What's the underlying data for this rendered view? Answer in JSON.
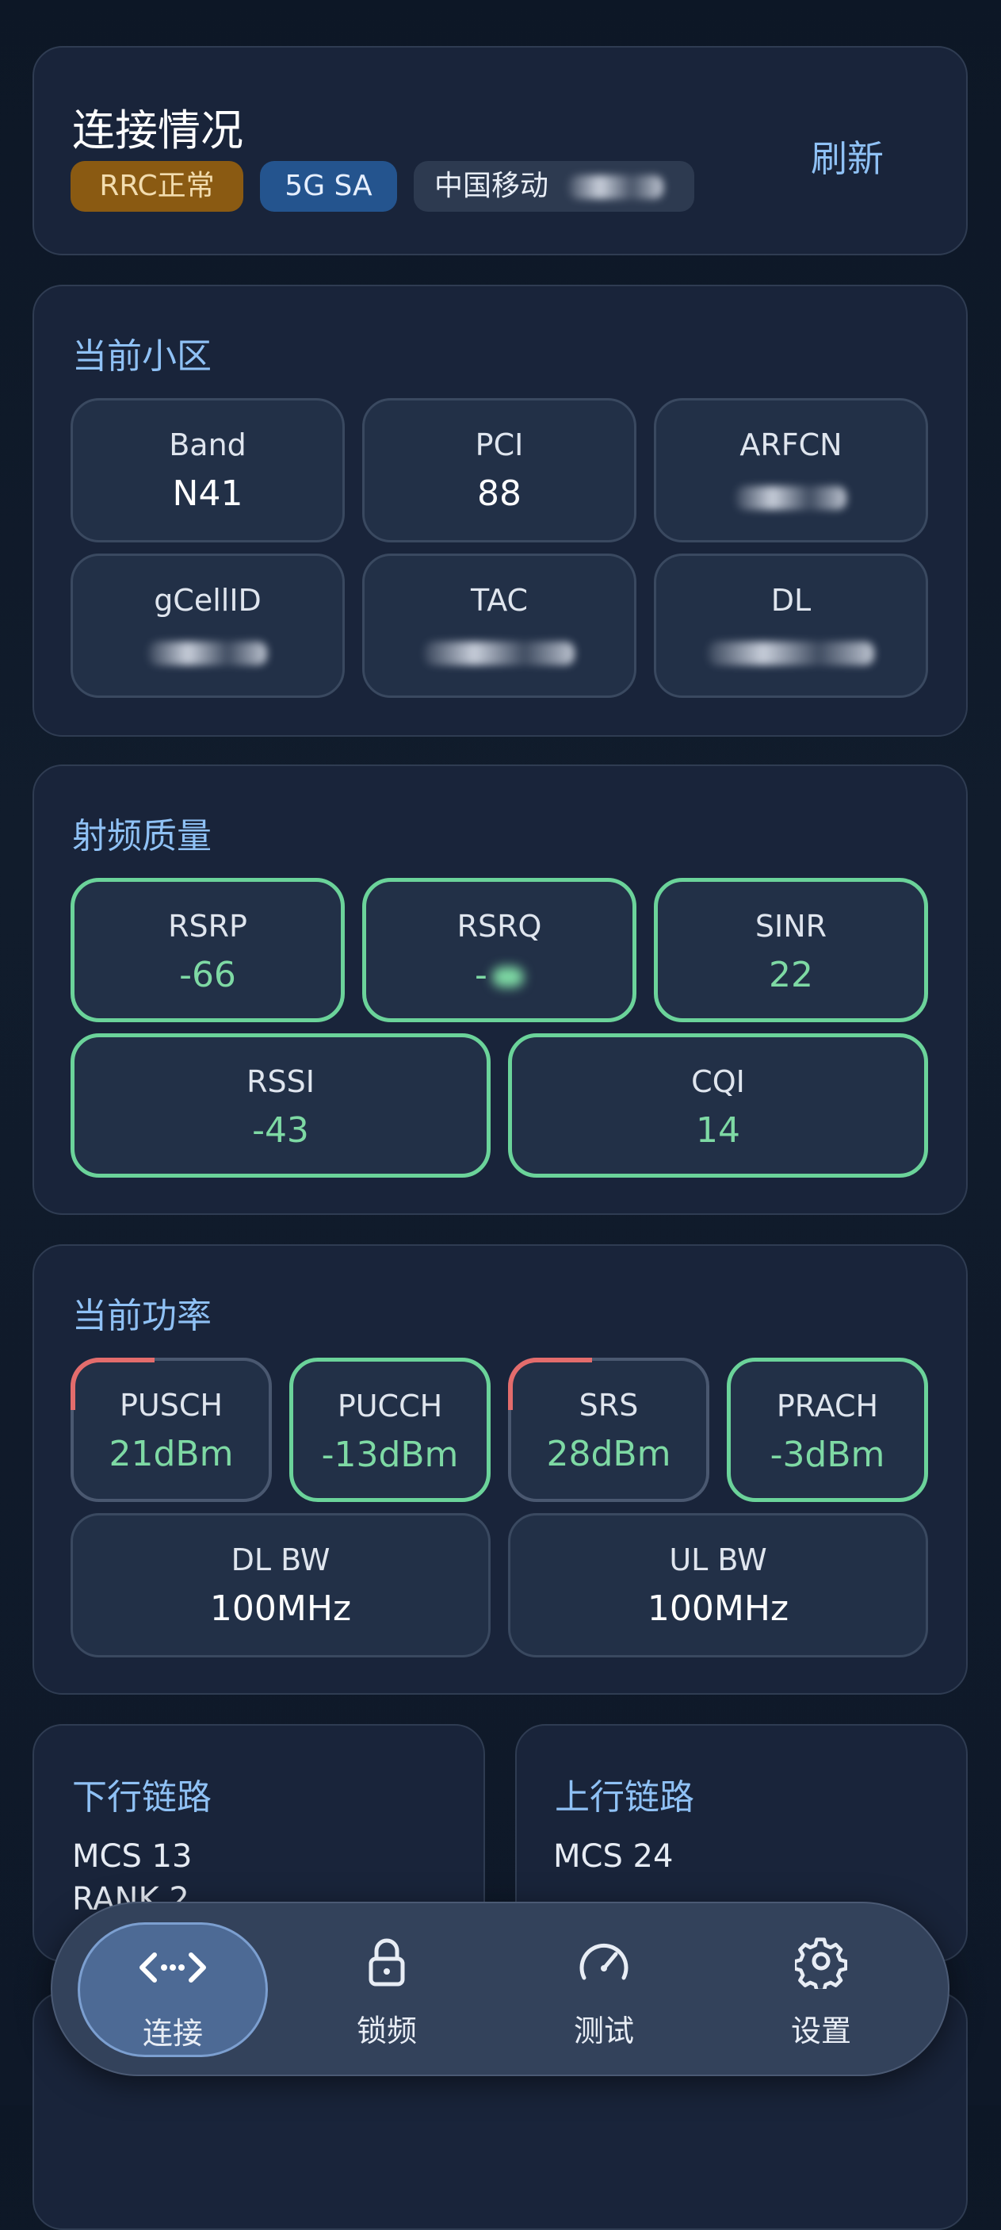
{
  "connection": {
    "title": "连接情况",
    "refresh_label": "刷新",
    "badges": {
      "rrc": "RRC正常",
      "mode": "5G SA",
      "carrier": "中国移动"
    }
  },
  "cell": {
    "title": "当前小区",
    "tiles": [
      {
        "label": "Band",
        "value": "N41"
      },
      {
        "label": "PCI",
        "value": "88"
      },
      {
        "label": "ARFCN",
        "value": ""
      },
      {
        "label": "gCellID",
        "value": ""
      },
      {
        "label": "TAC",
        "value": ""
      },
      {
        "label": "DL",
        "value": ""
      }
    ]
  },
  "rf": {
    "title": "射频质量",
    "tiles": [
      {
        "label": "RSRP",
        "value": "-66"
      },
      {
        "label": "RSRQ",
        "value": "-"
      },
      {
        "label": "SINR",
        "value": "22"
      },
      {
        "label": "RSSI",
        "value": "-43"
      },
      {
        "label": "CQI",
        "value": "14"
      }
    ]
  },
  "power": {
    "title": "当前功率",
    "tiles": [
      {
        "label": "PUSCH",
        "value": "21dBm"
      },
      {
        "label": "PUCCH",
        "value": "-13dBm"
      },
      {
        "label": "SRS",
        "value": "28dBm"
      },
      {
        "label": "PRACH",
        "value": "-3dBm"
      },
      {
        "label": "DL BW",
        "value": "100MHz"
      },
      {
        "label": "UL BW",
        "value": "100MHz"
      }
    ]
  },
  "downlink": {
    "title": "下行链路",
    "mcs": "MCS 13",
    "rank": "RANK 2"
  },
  "uplink": {
    "title": "上行链路",
    "mcs": "MCS 24"
  },
  "nav": {
    "items": [
      {
        "label": "连接",
        "icon": "connection-icon"
      },
      {
        "label": "锁频",
        "icon": "lock-icon"
      },
      {
        "label": "测试",
        "icon": "speedometer-icon"
      },
      {
        "label": "设置",
        "icon": "gear-icon"
      }
    ]
  },
  "colors": {
    "accent": "#8fc1f5",
    "good": "#6bd39a",
    "warn": "#e36c6c",
    "rrc_badge": "#8a5a12",
    "mode_badge": "#24548e"
  }
}
